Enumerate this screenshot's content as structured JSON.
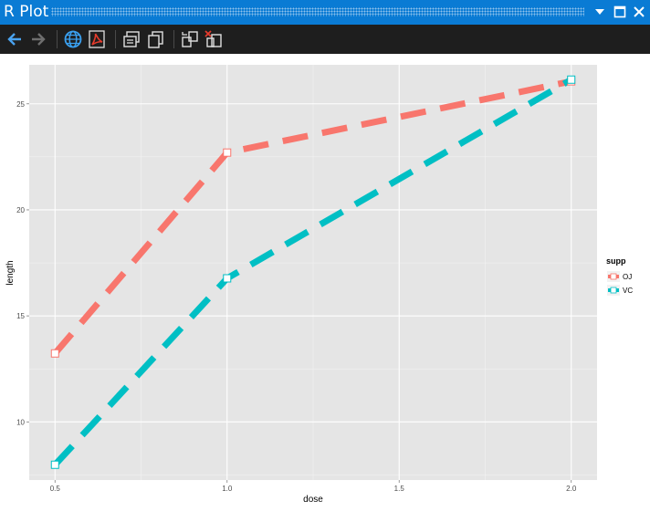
{
  "window": {
    "title": "R Plot"
  },
  "toolbar": {
    "icons": [
      "back-arrow-icon",
      "forward-arrow-icon",
      "globe-icon",
      "pdf-icon",
      "copy-window-icon",
      "copy-icon",
      "export-icon",
      "clear-icon"
    ]
  },
  "colors": {
    "titlebar": "#0a7bd4",
    "toolbar": "#1e1e1e",
    "panel": "#e5e5e5",
    "oj": "#f8766d",
    "vc": "#00bfc4"
  },
  "chart_data": {
    "type": "line",
    "x": [
      0.5,
      1.0,
      2.0
    ],
    "xticks": [
      "0.5",
      "1.0",
      "1.5",
      "2.0"
    ],
    "xtick_values": [
      0.5,
      1.0,
      1.5,
      2.0
    ],
    "yticks": [
      "10",
      "15",
      "20",
      "25"
    ],
    "ytick_values": [
      10,
      15,
      20,
      25
    ],
    "xlim": [
      0.425,
      2.075
    ],
    "ylim": [
      7.26,
      26.84
    ],
    "xlabel": "dose",
    "ylabel": "length",
    "legend_title": "supp",
    "legend_position": "right",
    "linetype": "dashed",
    "grid": true,
    "series": [
      {
        "name": "OJ",
        "values": [
          13.23,
          22.7,
          26.06
        ],
        "color": "#f8766d"
      },
      {
        "name": "VC",
        "values": [
          7.98,
          16.77,
          26.14
        ],
        "color": "#00bfc4"
      }
    ]
  }
}
